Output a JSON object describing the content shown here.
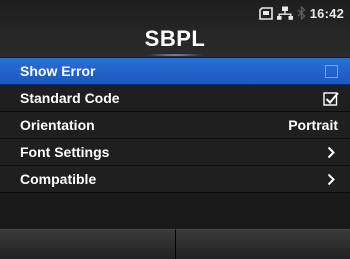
{
  "header": {
    "title": "SBPL",
    "status_icons": [
      "sd-card-icon",
      "network-icon",
      "bluetooth-icon"
    ],
    "time": "16:42"
  },
  "menu": {
    "items": [
      {
        "label": "Show Error",
        "control": "checkbox",
        "checked": false,
        "selected": true
      },
      {
        "label": "Standard Code",
        "control": "checkbox",
        "checked": true,
        "selected": false
      },
      {
        "label": "Orientation",
        "control": "value",
        "value": "Portrait",
        "selected": false
      },
      {
        "label": "Font Settings",
        "control": "submenu",
        "icon": "chevron-right-icon",
        "selected": false
      },
      {
        "label": "Compatible",
        "control": "submenu",
        "icon": "chevron-right-icon",
        "selected": false
      }
    ]
  },
  "colors": {
    "selected_row": "#1d58be",
    "background": "#1a1a1a",
    "text": "#ffffff"
  }
}
